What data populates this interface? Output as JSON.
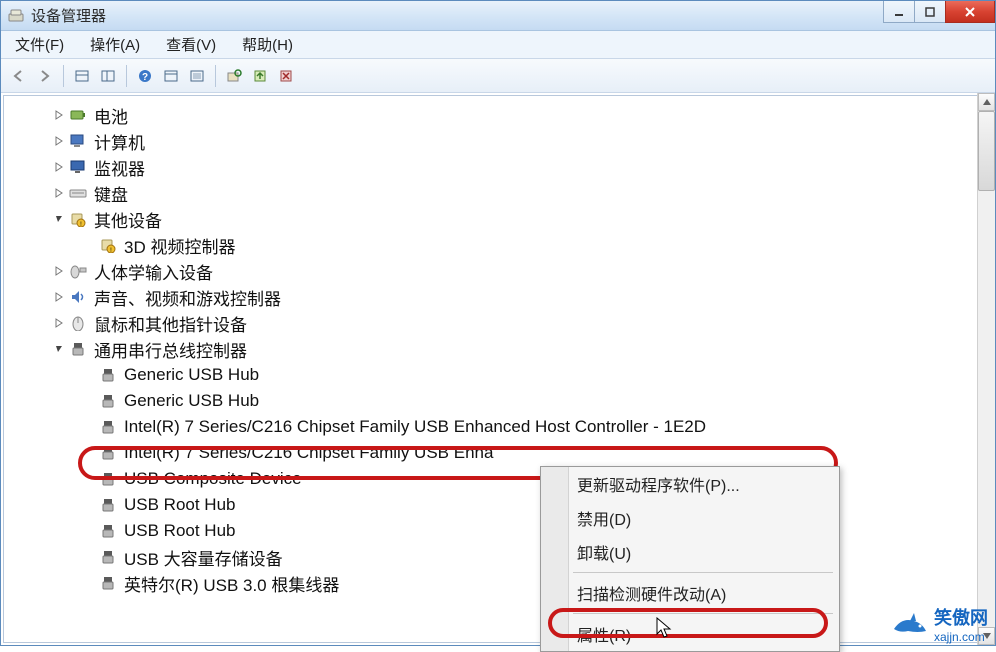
{
  "window": {
    "title": "设备管理器"
  },
  "menubar": {
    "file": "文件(F)",
    "action": "操作(A)",
    "view": "查看(V)",
    "help": "帮助(H)"
  },
  "tree": {
    "items": [
      {
        "label": "电池",
        "icon": "battery",
        "exp": "collapsed",
        "indent": 1
      },
      {
        "label": "计算机",
        "icon": "computer",
        "exp": "collapsed",
        "indent": 1
      },
      {
        "label": "监视器",
        "icon": "monitor",
        "exp": "collapsed",
        "indent": 1
      },
      {
        "label": "键盘",
        "icon": "keyboard",
        "exp": "collapsed",
        "indent": 1
      },
      {
        "label": "其他设备",
        "icon": "other",
        "exp": "expanded",
        "indent": 1
      },
      {
        "label": "3D 视频控制器",
        "icon": "warn",
        "exp": "none",
        "indent": 2
      },
      {
        "label": "人体学输入设备",
        "icon": "hid",
        "exp": "collapsed",
        "indent": 1
      },
      {
        "label": "声音、视频和游戏控制器",
        "icon": "sound",
        "exp": "collapsed",
        "indent": 1
      },
      {
        "label": "鼠标和其他指针设备",
        "icon": "mouse",
        "exp": "collapsed",
        "indent": 1
      },
      {
        "label": "通用串行总线控制器",
        "icon": "usb",
        "exp": "expanded",
        "indent": 1
      },
      {
        "label": "Generic USB Hub",
        "icon": "usb",
        "exp": "none",
        "indent": 2
      },
      {
        "label": "Generic USB Hub",
        "icon": "usb",
        "exp": "none",
        "indent": 2
      },
      {
        "label": "Intel(R) 7 Series/C216 Chipset Family USB Enhanced Host Controller - 1E2D",
        "icon": "usb",
        "exp": "none",
        "indent": 2
      },
      {
        "label": "Intel(R) 7 Series/C216 Chipset Family USB Enha",
        "icon": "usb",
        "exp": "none",
        "indent": 2
      },
      {
        "label": "USB Composite Device",
        "icon": "usb",
        "exp": "none",
        "indent": 2
      },
      {
        "label": "USB Root Hub",
        "icon": "usb",
        "exp": "none",
        "indent": 2
      },
      {
        "label": "USB Root Hub",
        "icon": "usb",
        "exp": "none",
        "indent": 2
      },
      {
        "label": "USB 大容量存储设备",
        "icon": "usb",
        "exp": "none",
        "indent": 2
      },
      {
        "label": "英特尔(R) USB 3.0 根集线器",
        "icon": "usb",
        "exp": "none",
        "indent": 2
      }
    ]
  },
  "context_menu": {
    "update": "更新驱动程序软件(P)...",
    "disable": "禁用(D)",
    "uninstall": "卸载(U)",
    "scan": "扫描检测硬件改动(A)",
    "properties": "属性(R)"
  },
  "watermark": {
    "name": "笑傲网",
    "domain": "xajjn.com"
  }
}
